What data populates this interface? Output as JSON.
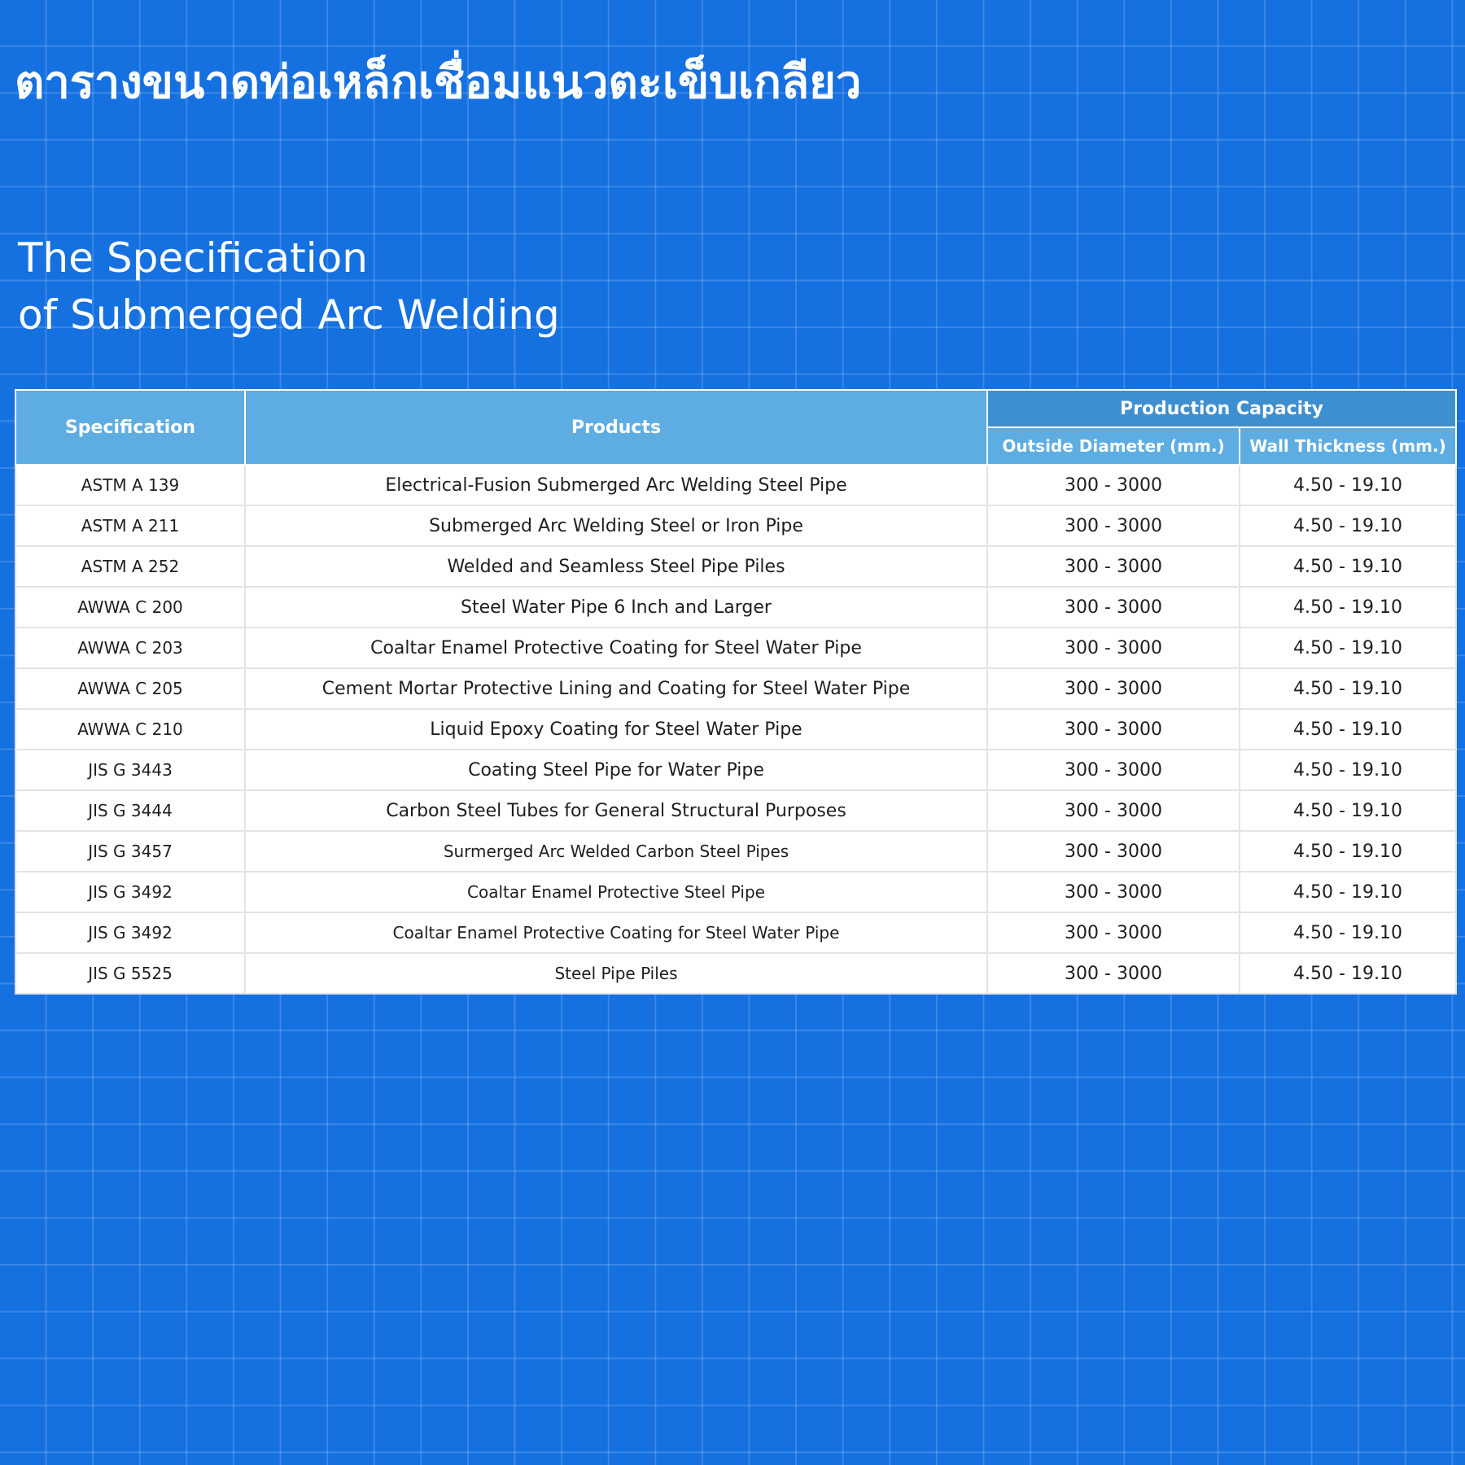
{
  "thai_title": "ตารางขนาดท่อเหล็กเชื่อมแนวตะเข็บเกลียว",
  "subtitle": {
    "line1": "The Specification",
    "line2": "of Submerged Arc Welding"
  },
  "table": {
    "headers": {
      "specification": "Specification",
      "products": "Products",
      "production_capacity": "Production Capacity",
      "outside_diameter": "Outside Diameter (mm.)",
      "wall_thickness": "Wall Thickness (mm.)"
    },
    "rows": [
      {
        "spec": "ASTM A 139",
        "product": "Electrical-Fusion Submerged Arc Welding Steel Pipe",
        "od": "300 - 3000",
        "wt": "4.50 - 19.10"
      },
      {
        "spec": "ASTM A 211",
        "product": "Submerged Arc Welding Steel or Iron Pipe",
        "od": "300 - 3000",
        "wt": "4.50 - 19.10"
      },
      {
        "spec": "ASTM A 252",
        "product": "Welded and Seamless Steel Pipe Piles",
        "od": "300 - 3000",
        "wt": "4.50 - 19.10"
      },
      {
        "spec": "AWWA C 200",
        "product": "Steel Water Pipe 6 Inch and Larger",
        "od": "300 - 3000",
        "wt": "4.50 - 19.10"
      },
      {
        "spec": "AWWA C 203",
        "product": "Coaltar Enamel Protective Coating for Steel Water Pipe",
        "od": "300 - 3000",
        "wt": "4.50 - 19.10"
      },
      {
        "spec": "AWWA C 205",
        "product": "Cement Mortar Protective Lining and Coating for Steel Water Pipe",
        "od": "300 - 3000",
        "wt": "4.50 - 19.10"
      },
      {
        "spec": "AWWA C 210",
        "product": "Liquid Epoxy Coating for Steel Water Pipe",
        "od": "300 - 3000",
        "wt": "4.50 - 19.10"
      },
      {
        "spec": "JIS G 3443",
        "product": "Coating Steel Pipe for Water Pipe",
        "od": "300 - 3000",
        "wt": "4.50 - 19.10"
      },
      {
        "spec": "JIS G 3444",
        "product": "Carbon Steel Tubes for General Structural Purposes",
        "od": "300 - 3000",
        "wt": "4.50 - 19.10"
      },
      {
        "spec": "JIS G 3457",
        "product": "Surmerged Arc Welded Carbon Steel Pipes",
        "od": "300 - 3000",
        "wt": "4.50 - 19.10"
      },
      {
        "spec": "JIS G 3492",
        "product": "Coaltar Enamel Protective Steel Pipe",
        "od": "300 - 3000",
        "wt": "4.50 - 19.10"
      },
      {
        "spec": "JIS G 3492",
        "product": "Coaltar Enamel Protective Coating for Steel Water Pipe",
        "od": "300 - 3000",
        "wt": "4.50 - 19.10"
      },
      {
        "spec": "JIS G 5525",
        "product": "Steel Pipe Piles",
        "od": "300 - 3000",
        "wt": "4.50 - 19.10"
      }
    ]
  },
  "colors": {
    "background": "#1570e0",
    "header": "#5dade2",
    "header_capacity": "#3d8fd0",
    "text": "#1e1e1e"
  }
}
